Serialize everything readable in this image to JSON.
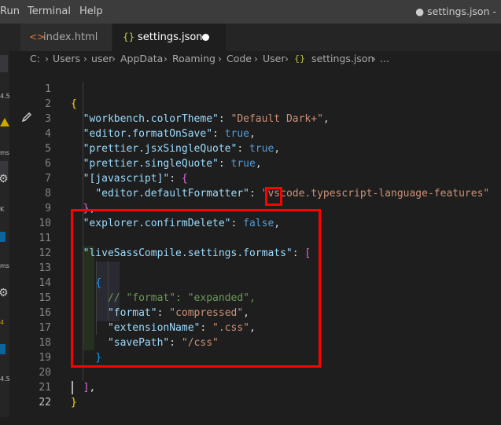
{
  "menubar": {
    "items": [
      "Run",
      "Terminal",
      "Help"
    ],
    "window_title": "● settings.json -"
  },
  "tabs": [
    {
      "icon": "<>",
      "label": "index.html",
      "active": false
    },
    {
      "icon": "{}",
      "label": "settings.json",
      "active": true,
      "dirty": true
    }
  ],
  "breadcrumb": [
    "C:",
    "Users",
    "user",
    "AppData",
    "Roaming",
    "Code",
    "User",
    "settings.json",
    "..."
  ],
  "sidebar_fragments": [
    "4.5",
    "ms",
    "K",
    "ms",
    "4",
    "4.5"
  ],
  "editor": {
    "lines": [
      {
        "n": "1"
      },
      {
        "n": "2"
      },
      {
        "n": "3"
      },
      {
        "n": "4"
      },
      {
        "n": "5"
      },
      {
        "n": "6"
      },
      {
        "n": "7"
      },
      {
        "n": "8"
      },
      {
        "n": "9"
      },
      {
        "n": "10"
      },
      {
        "n": "11"
      },
      {
        "n": "12"
      },
      {
        "n": "13"
      },
      {
        "n": "14"
      },
      {
        "n": "15"
      },
      {
        "n": "16"
      },
      {
        "n": "17"
      },
      {
        "n": "18"
      },
      {
        "n": "19"
      },
      {
        "n": "20"
      },
      {
        "n": "21"
      },
      {
        "n": "22"
      }
    ],
    "code": {
      "l1": "{",
      "l2_key": "\"workbench.colorTheme\"",
      "l2_val": "\"Default Dark+\"",
      "l3_key": "\"editor.formatOnSave\"",
      "l3_val": "true",
      "l4_key": "\"prettier.jsxSingleQuote\"",
      "l4_val": "true",
      "l5_key": "\"prettier.singleQuote\"",
      "l5_val": "true",
      "l6_key": "\"[javascript]\"",
      "l6_brace": "{",
      "l7_key": "\"editor.defaultFormatter\"",
      "l7_val": "\"vscode.typescript-language-features\"",
      "l8_brace": "}",
      "l9_key": "\"explorer.confirmDelete\"",
      "l9_val": "false",
      "l11_key": "\"liveSassCompile.settings.formats\"",
      "l11_bracket": "[",
      "l13_brace": "{",
      "l14_comment": "// \"format\": \"expanded\",",
      "l15_key": "\"format\"",
      "l15_val": "\"compressed\"",
      "l16_key": "\"extensionName\"",
      "l16_val": "\".css\"",
      "l17_key": "\"savePath\"",
      "l17_val": "\"/css\"",
      "l18_brace": "}",
      "l20_bracket": "]",
      "l21": "}"
    }
  },
  "colors": {
    "background": "#1e1e1e",
    "key": "#9cdcfe",
    "string": "#ce9178",
    "boolean": "#569cd6",
    "bracket_gold": "#ffd700",
    "bracket_orchid": "#da70d6",
    "bracket_blue": "#179fff",
    "comment": "#6a9955",
    "annotation_red": "#ff0000"
  }
}
